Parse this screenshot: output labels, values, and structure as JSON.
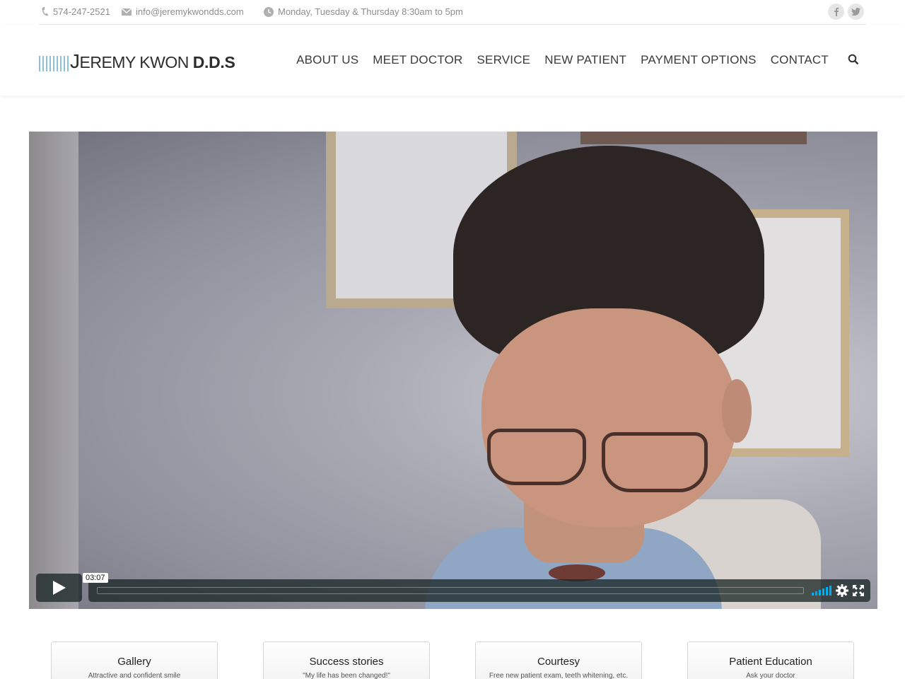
{
  "topbar": {
    "phone": "574-247-2521",
    "email": "info@jeremykwondds.com",
    "hours": "Monday, Tuesday & Thursday 8:30am to 5pm",
    "social": [
      {
        "name": "facebook",
        "glyph": "f"
      },
      {
        "name": "twitter",
        "glyph": "t"
      }
    ]
  },
  "header": {
    "logo_text": "EREMY KWON",
    "logo_initial": "J",
    "logo_suffix": "D.D.S",
    "nav": [
      "ABOUT US",
      "MEET DOCTOR",
      "SERVICE",
      "NEW PATIENT",
      "PAYMENT OPTIONS",
      "CONTACT"
    ]
  },
  "video": {
    "time": "03:07",
    "accent_color": "#00adef"
  },
  "features": [
    {
      "title": "Gallery",
      "subtitle": "Attractive and confident smile"
    },
    {
      "title": "Success stories",
      "subtitle": "\"My life has been changed!\""
    },
    {
      "title": "Courtesy",
      "subtitle": "Free new patient exam, teeth whitening, etc."
    },
    {
      "title": "Patient Education",
      "subtitle": "Ask your doctor"
    }
  ]
}
